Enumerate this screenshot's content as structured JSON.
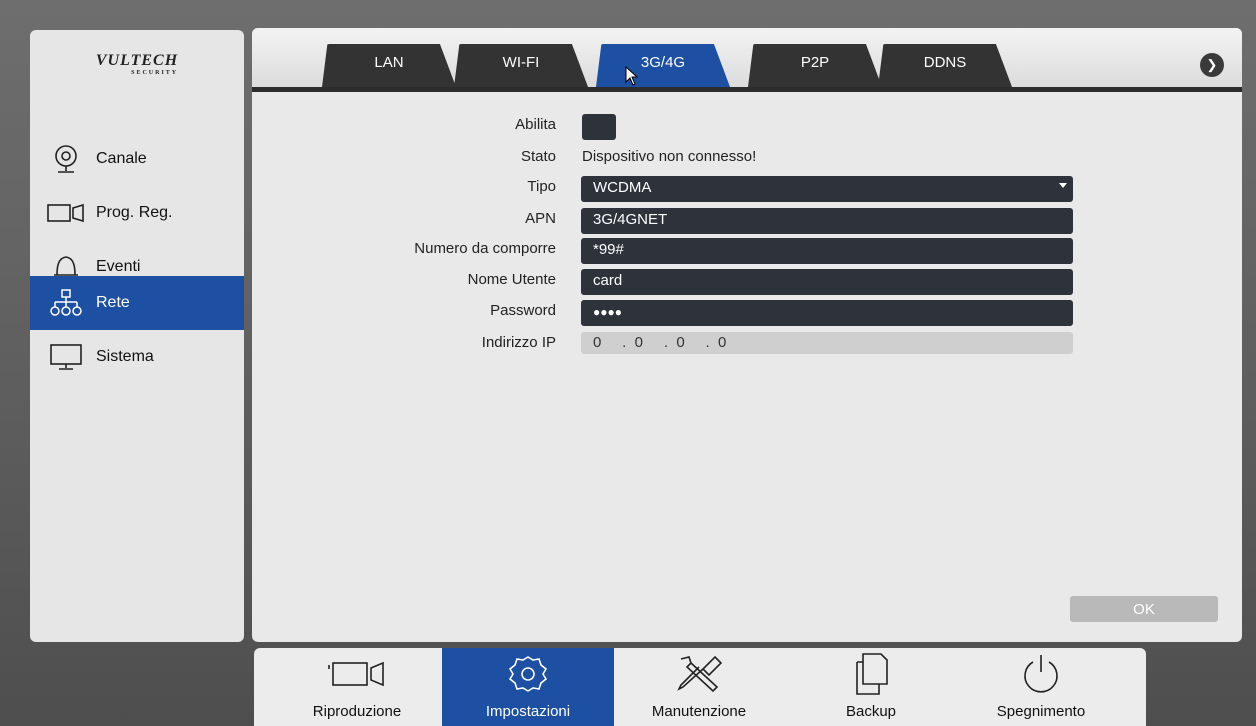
{
  "brand": {
    "name": "VULTECH",
    "sub": "SECURITY"
  },
  "sidebar": {
    "items": [
      {
        "label": "Canale",
        "icon": "camera-icon"
      },
      {
        "label": "Prog. Reg.",
        "icon": "record-schedule-icon"
      },
      {
        "label": "Eventi",
        "icon": "bell-icon"
      },
      {
        "label": "Rete",
        "icon": "network-icon",
        "active": true
      },
      {
        "label": "Sistema",
        "icon": "monitor-icon"
      }
    ]
  },
  "tabs": [
    {
      "label": "LAN"
    },
    {
      "label": "WI-FI"
    },
    {
      "label": "3G/4G",
      "active": true
    },
    {
      "label": "P2P"
    },
    {
      "label": "DDNS"
    }
  ],
  "form": {
    "enable_label": "Abilita",
    "status_label": "Stato",
    "status_value": "Dispositivo non connesso!",
    "type_label": "Tipo",
    "type_value": "WCDMA",
    "apn_label": "APN",
    "apn_value": "3G/4GNET",
    "dial_label": "Numero da comporre",
    "dial_value": "*99#",
    "user_label": "Nome Utente",
    "user_value": "card",
    "password_label": "Password",
    "password_value": "●●●●",
    "ip_label": "Indirizzo IP",
    "ip_value": "0     .  0     .  0     .  0"
  },
  "ok_label": "OK",
  "bottom": {
    "items": [
      {
        "label": "Riproduzione",
        "icon": "video-camera-icon"
      },
      {
        "label": "Impostazioni",
        "icon": "settings-gear-icon",
        "active": true
      },
      {
        "label": "Manutenzione",
        "icon": "tools-icon"
      },
      {
        "label": "Backup",
        "icon": "copy-icon"
      },
      {
        "label": "Spegnimento",
        "icon": "power-icon"
      }
    ]
  },
  "colors": {
    "accent": "#1d4fa3",
    "field_bg": "#2d323b",
    "tab_bg": "#333333"
  }
}
